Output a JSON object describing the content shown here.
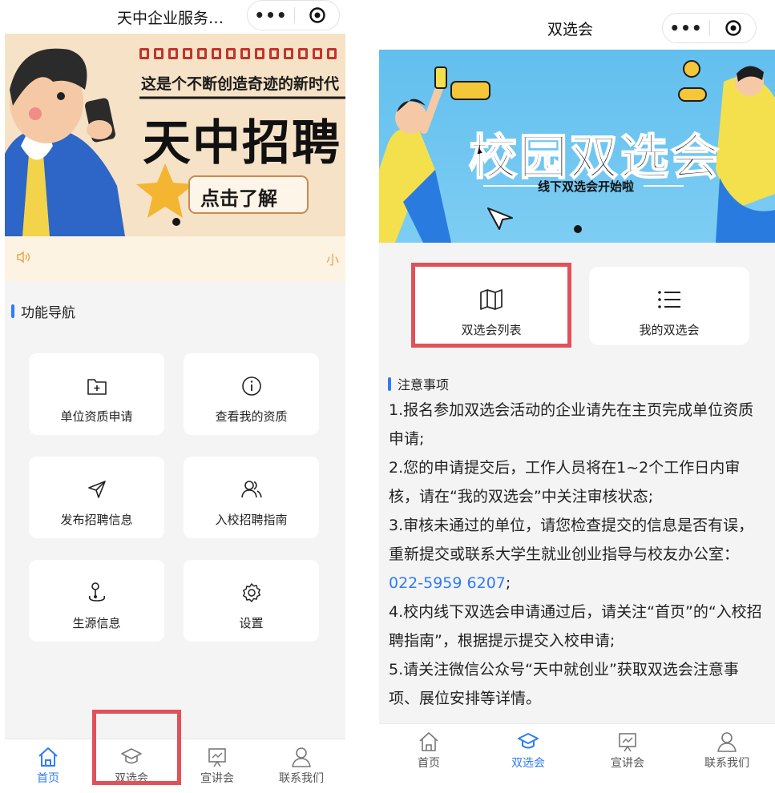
{
  "left": {
    "window_title": "天中企业服务…",
    "capsule_more": "•••",
    "banner": {
      "line1": "这是个不断创造奇迹的新时代",
      "headline": "天中招聘",
      "cta": "点击了解"
    },
    "notice_tail": "小",
    "section_title": "功能导航",
    "nav": [
      {
        "label": "单位资质申请",
        "icon": "folder-plus-icon"
      },
      {
        "label": "查看我的资质",
        "icon": "info-circle-icon"
      },
      {
        "label": "发布招聘信息",
        "icon": "send-icon"
      },
      {
        "label": "入校招聘指南",
        "icon": "users-icon"
      },
      {
        "label": "生源信息",
        "icon": "joystick-icon"
      },
      {
        "label": "设置",
        "icon": "gear-icon"
      }
    ],
    "tabs": [
      {
        "label": "首页",
        "icon": "home-icon",
        "active": true
      },
      {
        "label": "双选会",
        "icon": "graduation-cap-icon",
        "active": false
      },
      {
        "label": "宣讲会",
        "icon": "presentation-icon",
        "active": false
      },
      {
        "label": "联系我们",
        "icon": "user-icon",
        "active": false
      }
    ]
  },
  "right": {
    "window_title": "双选会",
    "capsule_more": "•••",
    "banner": {
      "headline": "校园双选会",
      "sub": "线下双选会开始啦"
    },
    "cards": [
      {
        "label": "双选会列表",
        "icon": "map-icon"
      },
      {
        "label": "我的双选会",
        "icon": "list-icon"
      }
    ],
    "section_title": "注意事项",
    "notes": [
      "1.报名参加双选会活动的企业请先在主页完成单位资质申请;",
      "2.您的申请提交后，工作人员将在1~2个工作日内审核，请在“我的双选会”中关注审核状态;",
      "3.审核未通过的单位，请您检查提交的信息是否有误，重新提交或联系大学生就业创业指导与校友办公室：",
      "4.校内线下双选会申请通过后，请关注“首页”的“入校招聘指南”，根据提示提交入校申请;",
      "5.请关注微信公众号“天中就创业”获取双选会注意事项、展位安排等详情。"
    ],
    "contact_phone": "022-5959 6207",
    "note3_end": ";",
    "tabs": [
      {
        "label": "首页",
        "icon": "home-icon",
        "active": false
      },
      {
        "label": "双选会",
        "icon": "graduation-cap-icon",
        "active": true
      },
      {
        "label": "宣讲会",
        "icon": "presentation-icon",
        "active": false
      },
      {
        "label": "联系我们",
        "icon": "user-icon",
        "active": false
      }
    ]
  },
  "colors": {
    "accent": "#2f7cf6",
    "highlight_frame": "#e2505a",
    "notice": "#e7a64b"
  }
}
